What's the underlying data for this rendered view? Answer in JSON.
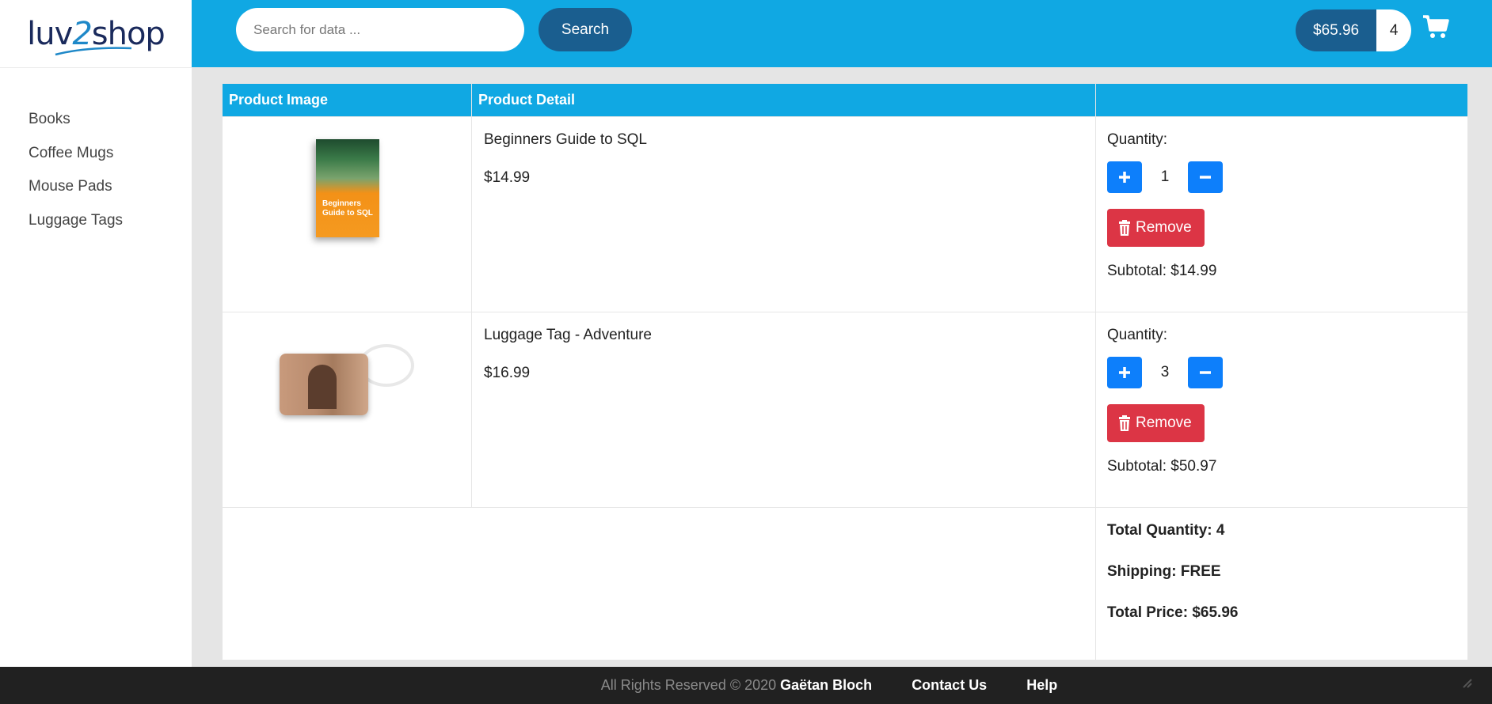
{
  "logo": {
    "part1": "luv",
    "part2": "2",
    "part3": "shop"
  },
  "sidebar": {
    "items": [
      {
        "label": "Books"
      },
      {
        "label": "Coffee Mugs"
      },
      {
        "label": "Mouse Pads"
      },
      {
        "label": "Luggage Tags"
      }
    ]
  },
  "header": {
    "search_placeholder": "Search for data ...",
    "search_button": "Search",
    "cart_total": "$65.96",
    "cart_count": "4",
    "cart_icon": "shopping-cart-icon"
  },
  "table": {
    "headers": [
      "Product Image",
      "Product Detail",
      ""
    ],
    "items": [
      {
        "name": "Beginners Guide to SQL",
        "price": "$14.99",
        "image_caption": "Beginners Guide to SQL",
        "quantity_label": "Quantity:",
        "quantity": "1",
        "remove_label": "Remove",
        "subtotal": "Subtotal: $14.99"
      },
      {
        "name": "Luggage Tag - Adventure",
        "price": "$16.99",
        "quantity_label": "Quantity:",
        "quantity": "3",
        "remove_label": "Remove",
        "subtotal": "Subtotal: $50.97"
      }
    ],
    "summary": {
      "total_quantity": "Total Quantity: 4",
      "shipping": "Shipping: FREE",
      "total_price": "Total Price: $65.96"
    }
  },
  "footer": {
    "copyright": "All Rights Reserved © 2020",
    "author": "Gaëtan Bloch",
    "contact": "Contact Us",
    "help": "Help"
  },
  "colors": {
    "header_blue": "#10a8e3",
    "dark_blue": "#1a5e8f",
    "qty_blue": "#0d7ffb",
    "remove_red": "#dc3545",
    "footer_bg": "#212121"
  }
}
